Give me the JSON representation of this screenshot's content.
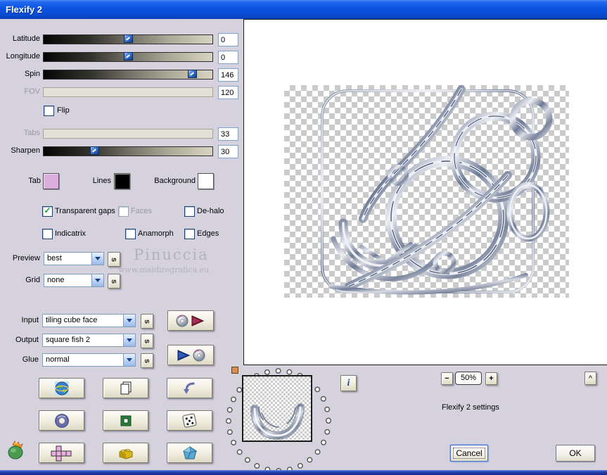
{
  "window": {
    "title": "Flexify 2"
  },
  "sliders": [
    {
      "label": "Latitude",
      "value": "0",
      "thumb_percent": 50,
      "disabled": false
    },
    {
      "label": "Longitude",
      "value": "0",
      "thumb_percent": 50,
      "disabled": false
    },
    {
      "label": "Spin",
      "value": "146",
      "thumb_percent": 88,
      "disabled": false
    },
    {
      "label": "FOV",
      "value": "120",
      "thumb_percent": null,
      "disabled": true
    },
    {
      "label": "Tabs",
      "value": "33",
      "thumb_percent": null,
      "disabled": true
    },
    {
      "label": "Sharpen",
      "value": "30",
      "thumb_percent": 30,
      "disabled": false
    }
  ],
  "flip": {
    "label": "Flip",
    "checked": false
  },
  "swatches": [
    {
      "label": "Tab",
      "color": "#dcaede"
    },
    {
      "label": "Lines",
      "color": "#000000"
    },
    {
      "label": "Background",
      "color": "#ffffff"
    }
  ],
  "checkbox_rows": [
    [
      {
        "label": "Transparent gaps",
        "checked": true,
        "disabled": false
      },
      {
        "label": "Faces",
        "checked": false,
        "disabled": true
      },
      {
        "label": "De-halo",
        "checked": false,
        "disabled": false
      }
    ],
    [
      {
        "label": "Indicatrix",
        "checked": false,
        "disabled": false
      },
      {
        "label": "Anamorph",
        "checked": false,
        "disabled": false
      },
      {
        "label": "Edges",
        "checked": false,
        "disabled": false
      }
    ]
  ],
  "selects": {
    "preview": {
      "label": "Preview",
      "value": "best"
    },
    "grid": {
      "label": "Grid",
      "value": "none"
    },
    "input": {
      "label": "Input",
      "value": "tiling cube face"
    },
    "output": {
      "label": "Output",
      "value": "square fish 2"
    },
    "glue": {
      "label": "Glue",
      "value": "normal"
    }
  },
  "shuffle_button_glyph": "s",
  "watermark": {
    "line1": "Pinuccia",
    "line2": "www.maidiregrafica.eu"
  },
  "info_button": {
    "glyph": "i"
  },
  "zoom_controls": {
    "minus": "−",
    "level": "50%",
    "plus": "+",
    "caret": "^"
  },
  "status_text": "Flexify 2 settings",
  "dialog_buttons": {
    "cancel": "Cancel",
    "ok": "OK"
  },
  "icon_buttons": [
    "globe",
    "copy-pages",
    "undo-arrow",
    "torus",
    "square-frame",
    "dice",
    "unfolded-cube",
    "lego-brick",
    "polyhedron"
  ],
  "colors": {
    "titlebar": "#0d53e2",
    "panel": "#d5d2de",
    "button_face": "#efecdc",
    "slider_thumb": "#3a72cc",
    "check_green": "#21a121"
  }
}
